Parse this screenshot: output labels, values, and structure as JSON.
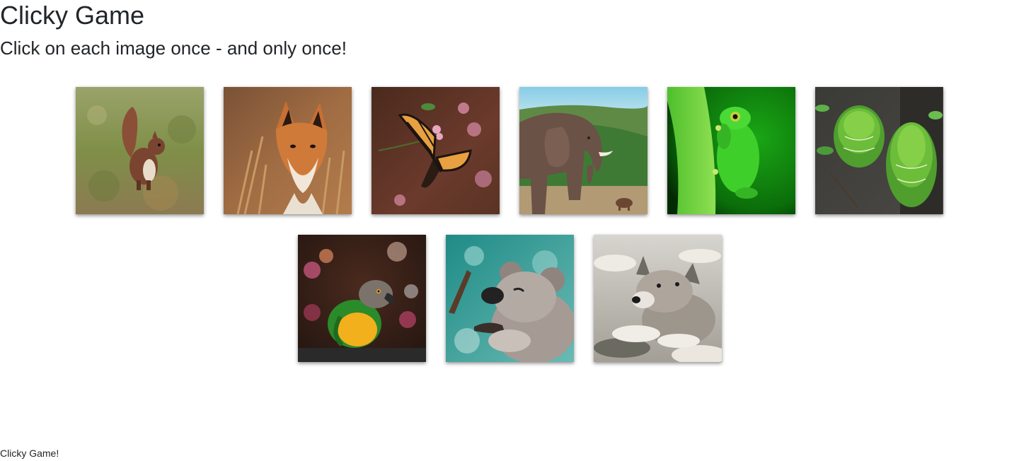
{
  "header": {
    "title": "Clicky Game",
    "subtitle": "Click on each image once - and only once!"
  },
  "cards": [
    {
      "name": "squirrel"
    },
    {
      "name": "fox"
    },
    {
      "name": "butterfly"
    },
    {
      "name": "elephant"
    },
    {
      "name": "frog"
    },
    {
      "name": "snake"
    },
    {
      "name": "parrot"
    },
    {
      "name": "koala"
    },
    {
      "name": "wolf-pup"
    }
  ],
  "footer": {
    "text": "Clicky Game!"
  }
}
